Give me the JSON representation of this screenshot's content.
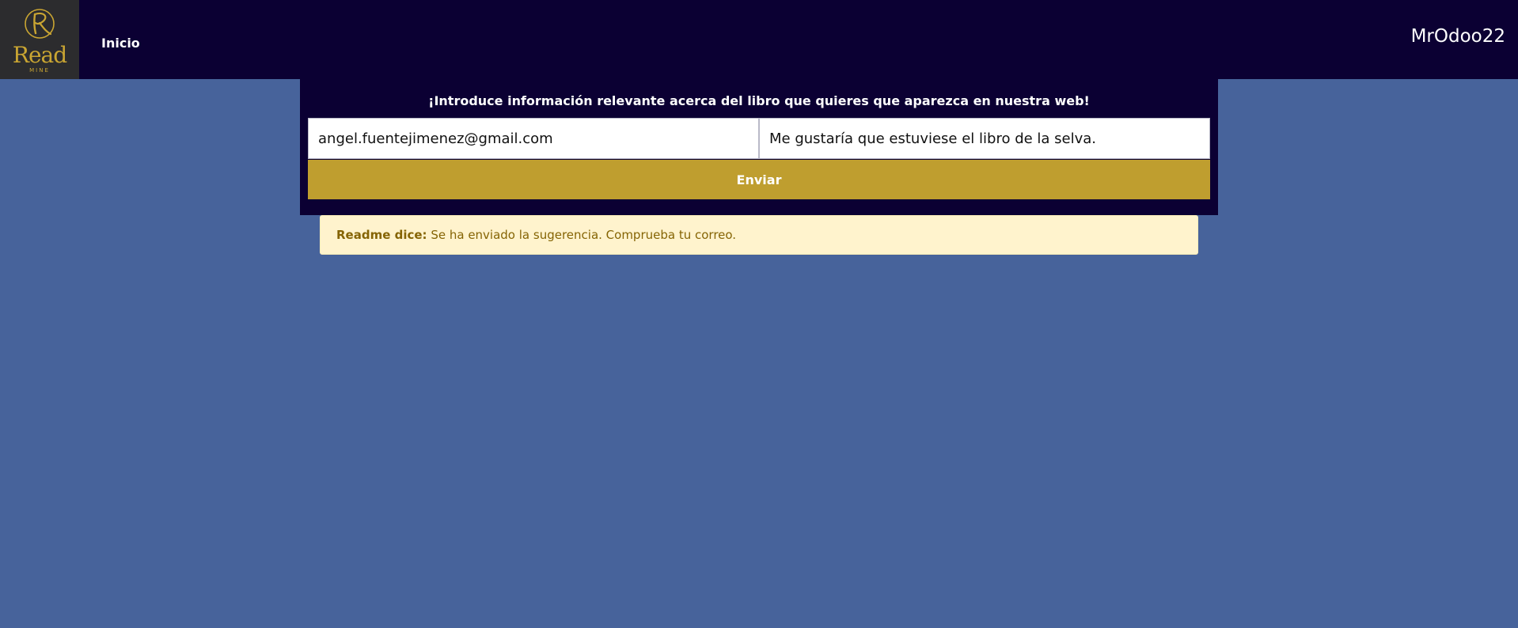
{
  "header": {
    "logo": {
      "word": "Read",
      "sub": "MINE",
      "initial": "R",
      "color": "#c9a532"
    },
    "nav": {
      "home_label": "Inicio"
    },
    "user": {
      "name": "MrOdoo22"
    }
  },
  "form": {
    "heading": "¡Introduce información relevante acerca del libro que quieres que aparezca en nuestra web!",
    "email_value": "angel.fuentejimenez@gmail.com",
    "suggestion_value": "Me gustaría que estuviese el libro de la selva.",
    "submit_label": "Enviar"
  },
  "alert": {
    "title": "Readme dice:",
    "message": " Se ha enviado la sugerencia. Comprueba tu correo."
  },
  "colors": {
    "background": "#47639b",
    "navbar": "#0b0033",
    "accent": "#bf9e2f",
    "alert_bg": "#fff3cd",
    "alert_text": "#856404"
  }
}
